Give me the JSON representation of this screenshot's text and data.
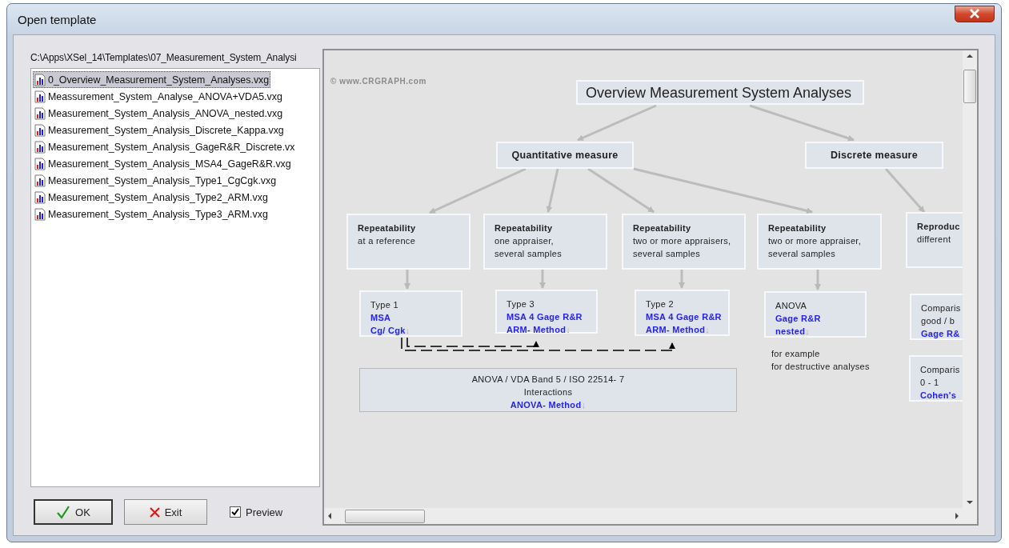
{
  "window": {
    "title": "Open template"
  },
  "path": "C:\\Apps\\XSel_14\\Templates\\07_Measurement_System_Analysi",
  "files": [
    {
      "name": "0_Overview_Measurement_System_Analyses.vxg",
      "selected": true
    },
    {
      "name": "Meassurement_System_Analyse_ANOVA+VDA5.vxg",
      "selected": false
    },
    {
      "name": "Measurement_System_Analysis_ANOVA_nested.vxg",
      "selected": false
    },
    {
      "name": "Measurement_System_Analysis_Discrete_Kappa.vxg",
      "selected": false
    },
    {
      "name": "Measurement_System_Analysis_GageR&R_Discrete.vx",
      "selected": false
    },
    {
      "name": "Measurement_System_Analysis_MSA4_GageR&R.vxg",
      "selected": false
    },
    {
      "name": "Measurement_System_Analysis_Type1_CgCgk.vxg",
      "selected": false
    },
    {
      "name": "Measurement_System_Analysis_Type2_ARM.vxg",
      "selected": false
    },
    {
      "name": "Measurement_System_Analysis_Type3_ARM.vxg",
      "selected": false
    }
  ],
  "buttons": [
    {
      "kind": "ok",
      "label": "OK"
    },
    {
      "kind": "exit",
      "label": "Exit"
    }
  ],
  "preview_option": {
    "label": "Preview",
    "checked": true
  },
  "preview": {
    "watermark": "© www.CRGRAPH.com",
    "nodes": [
      {
        "kind": "title",
        "lines": [
          {
            "kind": "text",
            "text": "Overview Measurement System Analyses"
          }
        ]
      },
      {
        "kind": "category",
        "lines": [
          {
            "kind": "heading",
            "text": "Quantitative measure"
          }
        ]
      },
      {
        "kind": "category",
        "lines": [
          {
            "kind": "heading",
            "text": "Discrete measure"
          }
        ]
      },
      {
        "kind": "box",
        "lines": [
          {
            "kind": "heading",
            "text": "Repeatability"
          },
          {
            "kind": "text",
            "text": "at a reference"
          }
        ]
      },
      {
        "kind": "box",
        "lines": [
          {
            "kind": "heading",
            "text": "Repeatability"
          },
          {
            "kind": "text",
            "text": "one appraiser,"
          },
          {
            "kind": "text",
            "text": "several samples"
          }
        ]
      },
      {
        "kind": "box",
        "lines": [
          {
            "kind": "heading",
            "text": "Repeatability"
          },
          {
            "kind": "text",
            "text": "two or more appraisers,"
          },
          {
            "kind": "text",
            "text": "several samples"
          }
        ]
      },
      {
        "kind": "box",
        "lines": [
          {
            "kind": "heading",
            "text": "Repeatability"
          },
          {
            "kind": "text",
            "text": "two or more appraiser,"
          },
          {
            "kind": "text",
            "text": "several samples"
          }
        ]
      },
      {
        "kind": "box",
        "lines": [
          {
            "kind": "heading",
            "text": "Reproduc"
          },
          {
            "kind": "text",
            "text": "different"
          }
        ]
      },
      {
        "kind": "box",
        "lines": [
          {
            "kind": "text",
            "text": "Type 1"
          },
          {
            "kind": "link",
            "text": "MSA"
          },
          {
            "kind": "link",
            "text": "Cg/ Cgk",
            "mark": "↓"
          }
        ]
      },
      {
        "kind": "box",
        "lines": [
          {
            "kind": "text",
            "text": "Type 3"
          },
          {
            "kind": "link",
            "text": "MSA 4 Gage R&R"
          },
          {
            "kind": "link",
            "text": "ARM- Method",
            "mark": "↓"
          }
        ]
      },
      {
        "kind": "box",
        "lines": [
          {
            "kind": "text",
            "text": "Type 2"
          },
          {
            "kind": "link",
            "text": "MSA 4 Gage R&R"
          },
          {
            "kind": "link",
            "text": "ARM- Method",
            "mark": "↓"
          }
        ]
      },
      {
        "kind": "box",
        "lines": [
          {
            "kind": "text",
            "text": "ANOVA"
          },
          {
            "kind": "link",
            "text": "Gage R&R"
          },
          {
            "kind": "link",
            "text": "nested",
            "mark": "↓"
          }
        ]
      },
      {
        "kind": "note",
        "lines": [
          {
            "kind": "text",
            "text": "for example"
          },
          {
            "kind": "text",
            "text": "for destructive analyses"
          }
        ]
      },
      {
        "kind": "box",
        "lines": [
          {
            "kind": "text",
            "text": "Comparis"
          },
          {
            "kind": "text",
            "text": "good /  b"
          },
          {
            "kind": "link",
            "text": "Gage R&"
          }
        ]
      },
      {
        "kind": "box",
        "lines": [
          {
            "kind": "text",
            "text": "Comparis"
          },
          {
            "kind": "text",
            "text": "0 - 1"
          },
          {
            "kind": "link",
            "text": "Cohen's"
          }
        ]
      },
      {
        "kind": "wide",
        "lines": [
          {
            "kind": "text",
            "text": "ANOVA /  VDA Band 5  /  ISO 22514- 7"
          },
          {
            "kind": "text",
            "text": "Interactions"
          },
          {
            "kind": "link",
            "text": "ANOVA- Method",
            "mark": "↓"
          }
        ]
      }
    ]
  }
}
